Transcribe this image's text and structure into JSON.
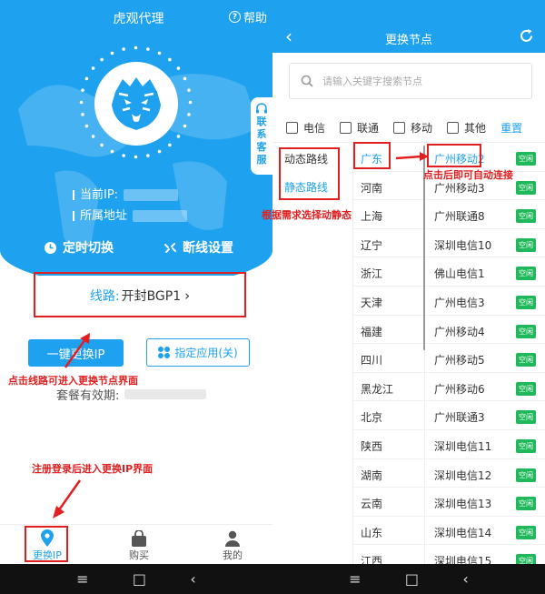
{
  "left": {
    "title": "虎观代理",
    "help_label": "帮助",
    "current_ip_label": "当前IP:",
    "location_label": "所属地址",
    "timer_switch_label": "定时切换",
    "disconnect_settings_label": "断线设置",
    "contact_service_label": "联系客服",
    "route": {
      "label": "线路:",
      "value": "开封BGP1",
      "chevron": "›"
    },
    "change_ip_button": "一键更换IP",
    "app_select_button": "指定应用(关)",
    "plan_expiry_label": "套餐有效期:",
    "tabs": [
      {
        "label": "更换IP",
        "icon": "location-pin-icon",
        "active": true
      },
      {
        "label": "购买",
        "icon": "shopping-bag-icon",
        "active": false
      },
      {
        "label": "我的",
        "icon": "user-icon",
        "active": false
      }
    ],
    "annotations": {
      "route_hint": "点击线路可进入更换节点界面",
      "login_hint": "注册登录后进入更换IP界面"
    }
  },
  "right": {
    "title": "更换节点",
    "search_placeholder": "请输入关键字搜索节点",
    "filters": [
      "电信",
      "联通",
      "移动",
      "其他"
    ],
    "reset_label": "重置",
    "route_types": [
      {
        "label": "动态路线",
        "active": false
      },
      {
        "label": "静态路线",
        "active": true
      }
    ],
    "provinces": [
      {
        "label": "广东",
        "active": true
      },
      {
        "label": "河南",
        "active": false
      },
      {
        "label": "上海",
        "active": false
      },
      {
        "label": "辽宁",
        "active": false
      },
      {
        "label": "浙江",
        "active": false
      },
      {
        "label": "天津",
        "active": false
      },
      {
        "label": "福建",
        "active": false
      },
      {
        "label": "四川",
        "active": false
      },
      {
        "label": "黑龙江",
        "active": false
      },
      {
        "label": "北京",
        "active": false
      },
      {
        "label": "陕西",
        "active": false
      },
      {
        "label": "湖南",
        "active": false
      },
      {
        "label": "云南",
        "active": false
      },
      {
        "label": "山东",
        "active": false
      },
      {
        "label": "江西",
        "active": false
      }
    ],
    "nodes": [
      {
        "label": "广州移动2",
        "status": "空闲",
        "active": true
      },
      {
        "label": "广州移动3",
        "status": "空闲",
        "active": false
      },
      {
        "label": "广州联通8",
        "status": "空闲",
        "active": false
      },
      {
        "label": "深圳电信10",
        "status": "空闲",
        "active": false
      },
      {
        "label": "佛山电信1",
        "status": "空闲",
        "active": false
      },
      {
        "label": "广州电信3",
        "status": "空闲",
        "active": false
      },
      {
        "label": "广州移动4",
        "status": "空闲",
        "active": false
      },
      {
        "label": "广州移动5",
        "status": "空闲",
        "active": false
      },
      {
        "label": "广州移动6",
        "status": "空闲",
        "active": false
      },
      {
        "label": "广州联通3",
        "status": "空闲",
        "active": false
      },
      {
        "label": "深圳电信11",
        "status": "空闲",
        "active": false
      },
      {
        "label": "深圳电信12",
        "status": "空闲",
        "active": false
      },
      {
        "label": "深圳电信13",
        "status": "空闲",
        "active": false
      },
      {
        "label": "深圳电信14",
        "status": "空闲",
        "active": false
      },
      {
        "label": "深圳电信15",
        "status": "空闲",
        "active": false
      }
    ],
    "annotations": {
      "node_hint": "点击后即可自动连接",
      "type_hint": "根据需求选择动静态"
    }
  },
  "system_nav": {
    "menu": "≡",
    "home": "□",
    "back": "‹"
  },
  "colors": {
    "primary": "#1ea1ee",
    "annotation": "#e02020",
    "badge": "#1fb85a"
  }
}
